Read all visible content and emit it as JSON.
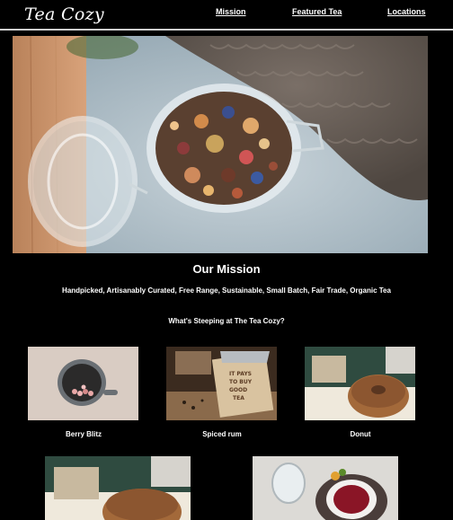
{
  "site": {
    "logo": "Tea Cozy"
  },
  "nav": {
    "mission": "Mission",
    "featured": "Featured Tea",
    "locations": "Locations"
  },
  "mission": {
    "title": "Our Mission",
    "tagline": "Handpicked, Artisanably Curated, Free Range, Sustainable, Small Batch, Fair Trade, Organic Tea"
  },
  "featured": {
    "title": "What's Steeping at The Tea Cozy?",
    "items": [
      {
        "label": "Berry Blitz"
      },
      {
        "label": "Spiced rum"
      },
      {
        "label": "Donut"
      }
    ]
  },
  "sign_text": "IT PAYS TO BUY GOOD TEA",
  "colors": {
    "background": "#000000",
    "text": "#ffffff",
    "divider": "#cfcfcf"
  }
}
